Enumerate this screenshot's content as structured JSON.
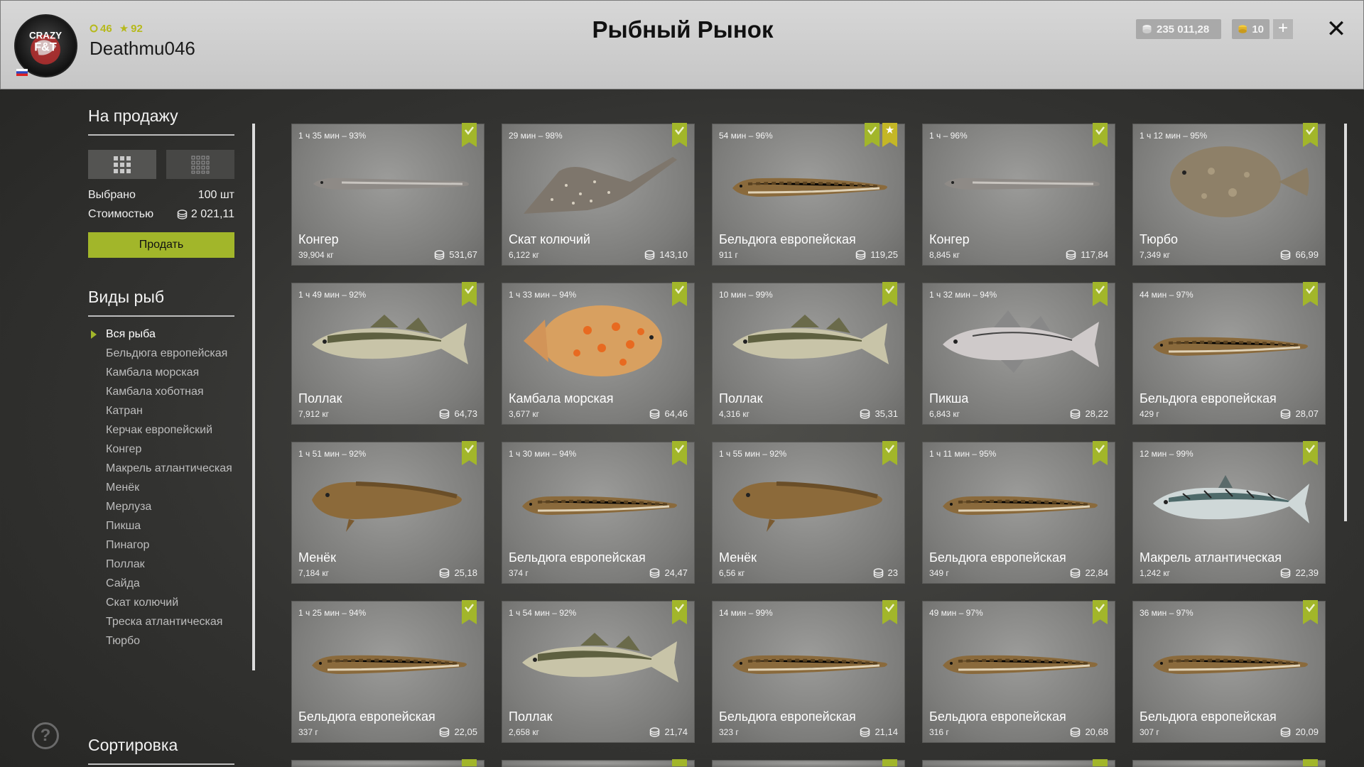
{
  "header": {
    "title": "Рыбный Рынок",
    "avatar_text": "CRAZY F&T",
    "level": "46",
    "rank": "92",
    "username": "Deathmu046",
    "silver": "235 011,28",
    "gold": "10",
    "plus": "+",
    "close": "✕"
  },
  "sidebar": {
    "for_sale_title": "На продажу",
    "selected_label": "Выбрано",
    "selected_value": "100 шт",
    "cost_label": "Стоимостью",
    "cost_value": "2 021,11",
    "sell_label": "Продать",
    "types_title": "Виды рыб",
    "types": [
      "Вся рыба",
      "Бельдюга европейская",
      "Камбала морская",
      "Камбала хоботная",
      "Катран",
      "Керчак европейский",
      "Конгер",
      "Макрель атлантическая",
      "Менёк",
      "Мерлуза",
      "Пикша",
      "Пинагор",
      "Поллак",
      "Сайда",
      "Скат колючий",
      "Треска атлантическая",
      "Тюрбо"
    ],
    "sort_title": "Сортировка",
    "help": "?"
  },
  "colors": {
    "accent": "#a2b62a",
    "star": "#c4b726"
  },
  "fish": [
    {
      "time": "1 ч 35 мин – 93%",
      "name": "Конгер",
      "weight": "39,904 кг",
      "price": "531,67",
      "kind": "eel",
      "star": false
    },
    {
      "time": "29 мин – 98%",
      "name": "Скат колючий",
      "weight": "6,122 кг",
      "price": "143,10",
      "kind": "ray",
      "star": false
    },
    {
      "time": "54 мин – 96%",
      "name": "Бельдюга европейская",
      "weight": "911 г",
      "price": "119,25",
      "kind": "eelpout",
      "star": true
    },
    {
      "time": "1 ч – 96%",
      "name": "Конгер",
      "weight": "8,845 кг",
      "price": "117,84",
      "kind": "eel",
      "star": false
    },
    {
      "time": "1 ч 12 мин – 95%",
      "name": "Тюрбо",
      "weight": "7,349 кг",
      "price": "66,99",
      "kind": "turbot",
      "star": false
    },
    {
      "time": "1 ч 49 мин – 92%",
      "name": "Поллак",
      "weight": "7,912 кг",
      "price": "64,73",
      "kind": "cod",
      "star": false
    },
    {
      "time": "1 ч 33 мин – 94%",
      "name": "Камбала морская",
      "weight": "3,677 кг",
      "price": "64,46",
      "kind": "plaice",
      "star": false
    },
    {
      "time": "10 мин – 99%",
      "name": "Поллак",
      "weight": "4,316 кг",
      "price": "35,31",
      "kind": "cod",
      "star": false
    },
    {
      "time": "1 ч 32 мин – 94%",
      "name": "Пикша",
      "weight": "6,843 кг",
      "price": "28,22",
      "kind": "haddock",
      "star": false
    },
    {
      "time": "44 мин – 97%",
      "name": "Бельдюга европейская",
      "weight": "429 г",
      "price": "28,07",
      "kind": "eelpout",
      "star": false
    },
    {
      "time": "1 ч 51 мин – 92%",
      "name": "Менёк",
      "weight": "7,184 кг",
      "price": "25,18",
      "kind": "tusk",
      "star": false
    },
    {
      "time": "1 ч 30 мин – 94%",
      "name": "Бельдюга европейская",
      "weight": "374 г",
      "price": "24,47",
      "kind": "eelpout",
      "star": false
    },
    {
      "time": "1 ч 55 мин – 92%",
      "name": "Менёк",
      "weight": "6,56 кг",
      "price": "23",
      "kind": "tusk",
      "star": false
    },
    {
      "time": "1 ч 11 мин – 95%",
      "name": "Бельдюга европейская",
      "weight": "349 г",
      "price": "22,84",
      "kind": "eelpout",
      "star": false
    },
    {
      "time": "12 мин – 99%",
      "name": "Макрель атлантическая",
      "weight": "1,242 кг",
      "price": "22,39",
      "kind": "mackerel",
      "star": false
    },
    {
      "time": "1 ч 25 мин – 94%",
      "name": "Бельдюга европейская",
      "weight": "337 г",
      "price": "22,05",
      "kind": "eelpout",
      "star": false
    },
    {
      "time": "1 ч 54 мин – 92%",
      "name": "Поллак",
      "weight": "2,658 кг",
      "price": "21,74",
      "kind": "cod",
      "star": false
    },
    {
      "time": "14 мин – 99%",
      "name": "Бельдюга европейская",
      "weight": "323 г",
      "price": "21,14",
      "kind": "eelpout",
      "star": false
    },
    {
      "time": "49 мин – 97%",
      "name": "Бельдюга европейская",
      "weight": "316 г",
      "price": "20,68",
      "kind": "eelpout",
      "star": false
    },
    {
      "time": "36 мин – 97%",
      "name": "Бельдюга европейская",
      "weight": "307 г",
      "price": "20,09",
      "kind": "eelpout",
      "star": false
    }
  ]
}
